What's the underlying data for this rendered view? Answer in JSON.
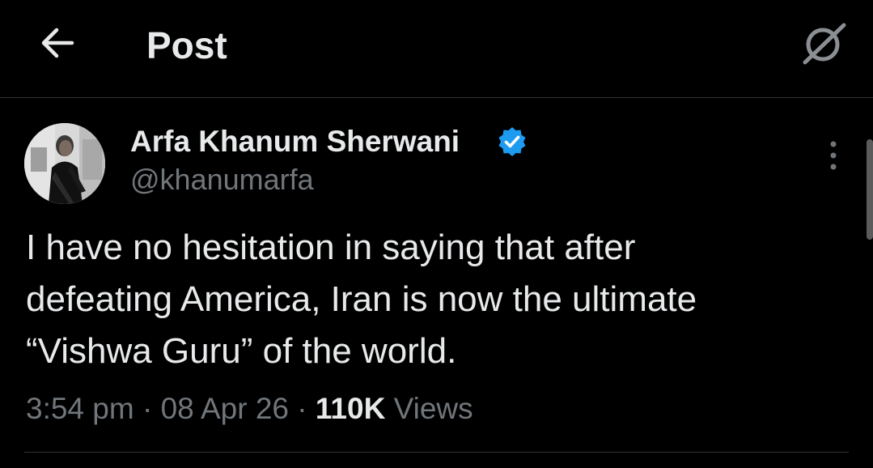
{
  "header": {
    "back_icon": "arrow-left-icon",
    "title": "Post",
    "grok_icon": "grok-icon"
  },
  "post": {
    "author": {
      "name": "Arfa Khanum Sherwani",
      "handle": "@khanumarfa",
      "verified": true,
      "verified_color": "#1d9bf0"
    },
    "more_icon": "more-vertical-icon",
    "text_lines": [
      "I have no hesitation in saying that after",
      "defeating America, Iran is now the ultimate",
      "“Vishwa Guru” of the world."
    ],
    "time": "3:54 pm",
    "date": "08 Apr 26",
    "separator": "·",
    "views_count": "110K",
    "views_label": "Views"
  },
  "colors": {
    "background": "#000000",
    "primary_text": "#e7e9ea",
    "secondary_text": "#71767b",
    "border": "#2f3336"
  }
}
